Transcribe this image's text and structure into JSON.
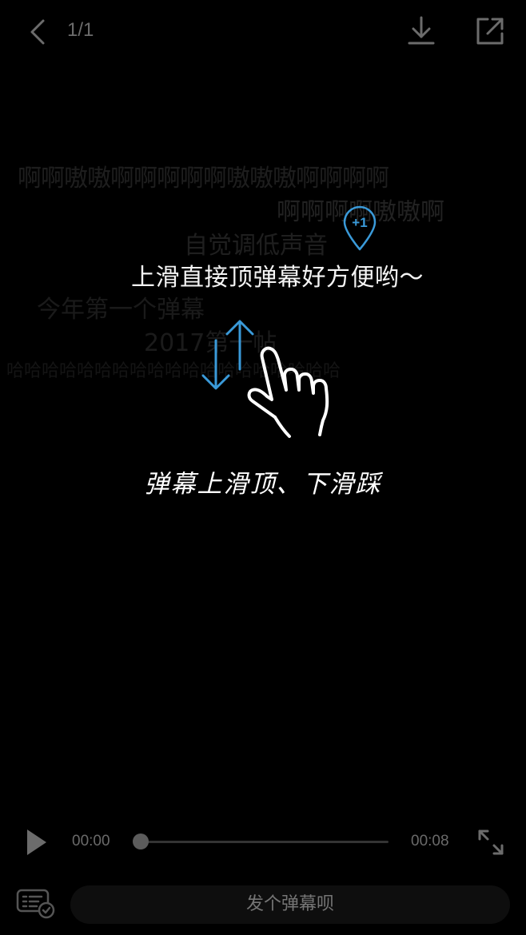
{
  "top_bar": {
    "page_counter": "1/1",
    "icons": {
      "back": "chevron-left-icon",
      "download": "download-icon",
      "share": "share-icon"
    }
  },
  "danmaku": [
    "啊啊嗷嗷啊啊啊啊啊嗷嗷嗷啊啊啊啊",
    "啊啊啊啊嗷嗷啊",
    "自觉调低声音",
    "今年第一个弹幕",
    "2017第一帖",
    "哈哈哈哈哈哈哈哈哈哈哈哈哈哈哈哈哈哈哈"
  ],
  "highlight_comment": {
    "text": "上滑直接顶弹幕好方便哟～",
    "badge": "+1"
  },
  "tutorial": {
    "caption": "弹幕上滑顶、下滑踩"
  },
  "player": {
    "time_current": "00:00",
    "time_total": "00:08",
    "progress": 0
  },
  "bottom": {
    "input_placeholder": "发个弹幕呗"
  },
  "colors": {
    "background": "#000000",
    "accent_blue": "#3a9ad9",
    "muted_text": "#6a6a6a"
  }
}
